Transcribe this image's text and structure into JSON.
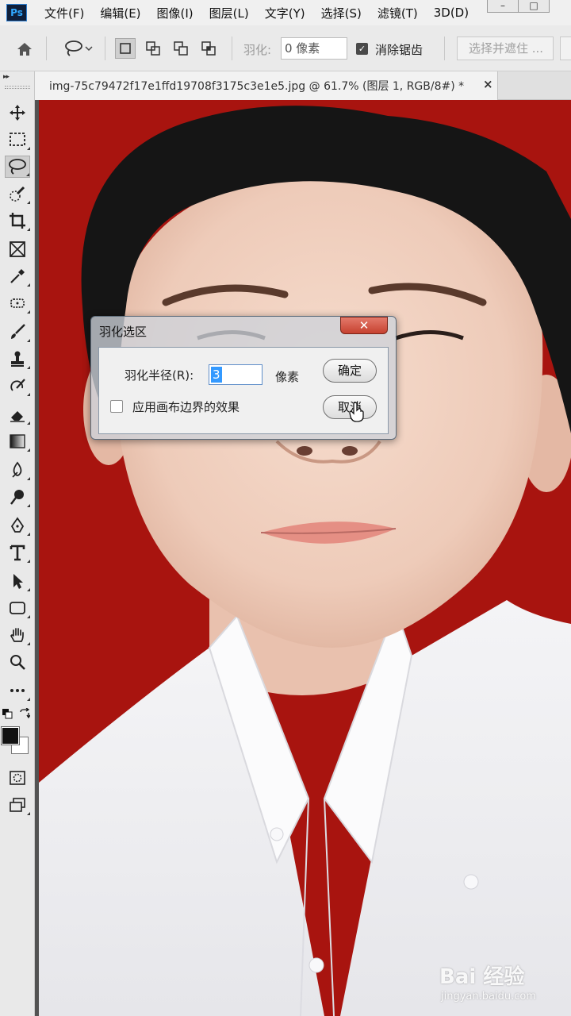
{
  "app": {
    "logo_text": "Ps",
    "menu": [
      "文件(F)",
      "编辑(E)",
      "图像(I)",
      "图层(L)",
      "文字(Y)",
      "选择(S)",
      "滤镜(T)",
      "3D(D)"
    ],
    "window_controls": [
      "minimize",
      "maximize"
    ]
  },
  "options_bar": {
    "feather_label": "羽化:",
    "feather_value": "0 像素",
    "antialias_label": "消除锯齿",
    "antialias_checked": true,
    "select_and_mask_label": "选择并遮住 ...",
    "selection_modes": [
      "new-selection",
      "add-to-selection",
      "subtract-from-selection",
      "intersect-selection"
    ],
    "active_selection_mode": "new-selection"
  },
  "toolbar": {
    "tools": [
      "move-tool",
      "marquee-tool",
      "lasso-tool",
      "quick-selection-tool",
      "crop-tool",
      "frame-tool",
      "eyedropper-tool",
      "healing-brush-tool",
      "brush-tool",
      "clone-stamp-tool",
      "history-brush-tool",
      "eraser-tool",
      "gradient-tool",
      "blur-tool",
      "dodge-tool",
      "pen-tool",
      "type-tool",
      "path-selection-tool",
      "rectangle-tool",
      "hand-tool",
      "zoom-tool",
      "more-tools"
    ],
    "active_tool": "lasso-tool",
    "foreground_color": "#111111",
    "background_color": "#ffffff"
  },
  "document": {
    "tab_title": "img-75c79472f17e1ffd19708f3175c3e1e5.jpg @ 61.7% (图层 1, RGB/8#) *",
    "close_symbol": "×"
  },
  "dialog": {
    "title": "羽化选区",
    "radius_label": "羽化半径(R):",
    "radius_value": "3",
    "unit": "像素",
    "ok_label": "确定",
    "cancel_label": "取消",
    "apply_canvas_bounds_label": "应用画布边界的效果",
    "apply_canvas_bounds_checked": false,
    "close_symbol": "✕"
  },
  "watermark": {
    "brand": "Bai 经验",
    "url": "jingyan.baidu.com"
  },
  "colors": {
    "photo_background": "#a8140f",
    "selection_highlight": "#3399ff"
  }
}
